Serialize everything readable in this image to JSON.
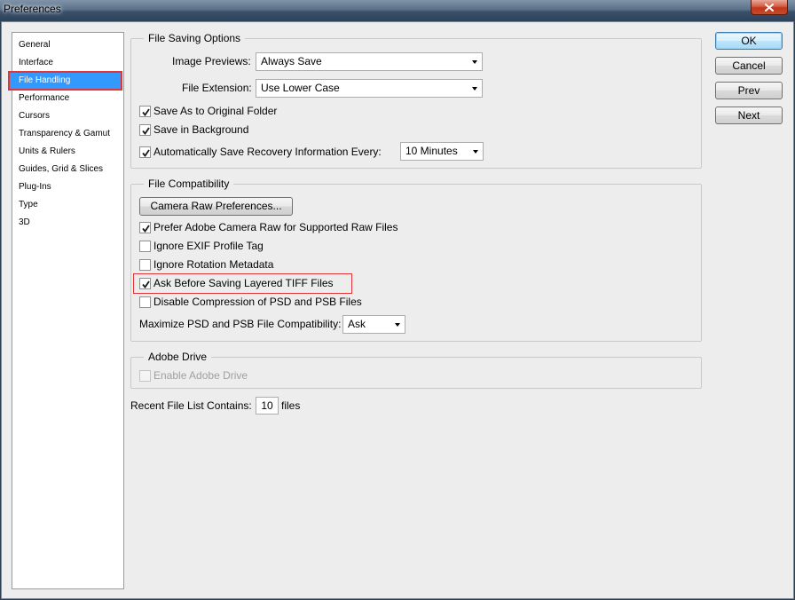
{
  "window": {
    "title": "Preferences"
  },
  "sidebar": {
    "items": [
      {
        "label": "General"
      },
      {
        "label": "Interface"
      },
      {
        "label": "File Handling",
        "selected": true
      },
      {
        "label": "Performance"
      },
      {
        "label": "Cursors"
      },
      {
        "label": "Transparency & Gamut"
      },
      {
        "label": "Units & Rulers"
      },
      {
        "label": "Guides, Grid & Slices"
      },
      {
        "label": "Plug-Ins"
      },
      {
        "label": "Type"
      },
      {
        "label": "3D"
      }
    ]
  },
  "file_saving": {
    "legend": "File Saving Options",
    "image_previews_label": "Image Previews:",
    "image_previews_value": "Always Save",
    "file_extension_label": "File Extension:",
    "file_extension_value": "Use Lower Case",
    "save_as_original": {
      "label": "Save As to Original Folder",
      "checked": true
    },
    "save_in_background": {
      "label": "Save in Background",
      "checked": true
    },
    "auto_recovery": {
      "label": "Automatically Save Recovery Information Every:",
      "checked": true
    },
    "recovery_interval": "10 Minutes"
  },
  "file_compat": {
    "legend": "File Compatibility",
    "camera_raw_button": "Camera Raw Preferences...",
    "prefer_camera_raw": {
      "label": "Prefer Adobe Camera Raw for Supported Raw Files",
      "checked": true
    },
    "ignore_exif": {
      "label": "Ignore EXIF Profile Tag",
      "checked": false
    },
    "ignore_rotation": {
      "label": "Ignore Rotation Metadata",
      "checked": false
    },
    "ask_tiff": {
      "label": "Ask Before Saving Layered TIFF Files",
      "checked": true
    },
    "disable_compression": {
      "label": "Disable Compression of PSD and PSB Files",
      "checked": false
    },
    "maximize_label": "Maximize PSD and PSB File Compatibility:",
    "maximize_value": "Ask"
  },
  "adobe_drive": {
    "legend": "Adobe Drive",
    "enable": {
      "label": "Enable Adobe Drive",
      "checked": false,
      "disabled": true
    }
  },
  "recent_files": {
    "label": "Recent File List Contains:",
    "value": "10",
    "suffix": "files"
  },
  "buttons": {
    "ok": "OK",
    "cancel": "Cancel",
    "prev": "Prev",
    "next": "Next"
  },
  "colors": {
    "accent": "#3399ff",
    "highlight": "#e0353a"
  },
  "icons": {
    "checkbox_check": "check-icon",
    "dropdown": "chevron-down-icon",
    "close": "close-icon"
  }
}
